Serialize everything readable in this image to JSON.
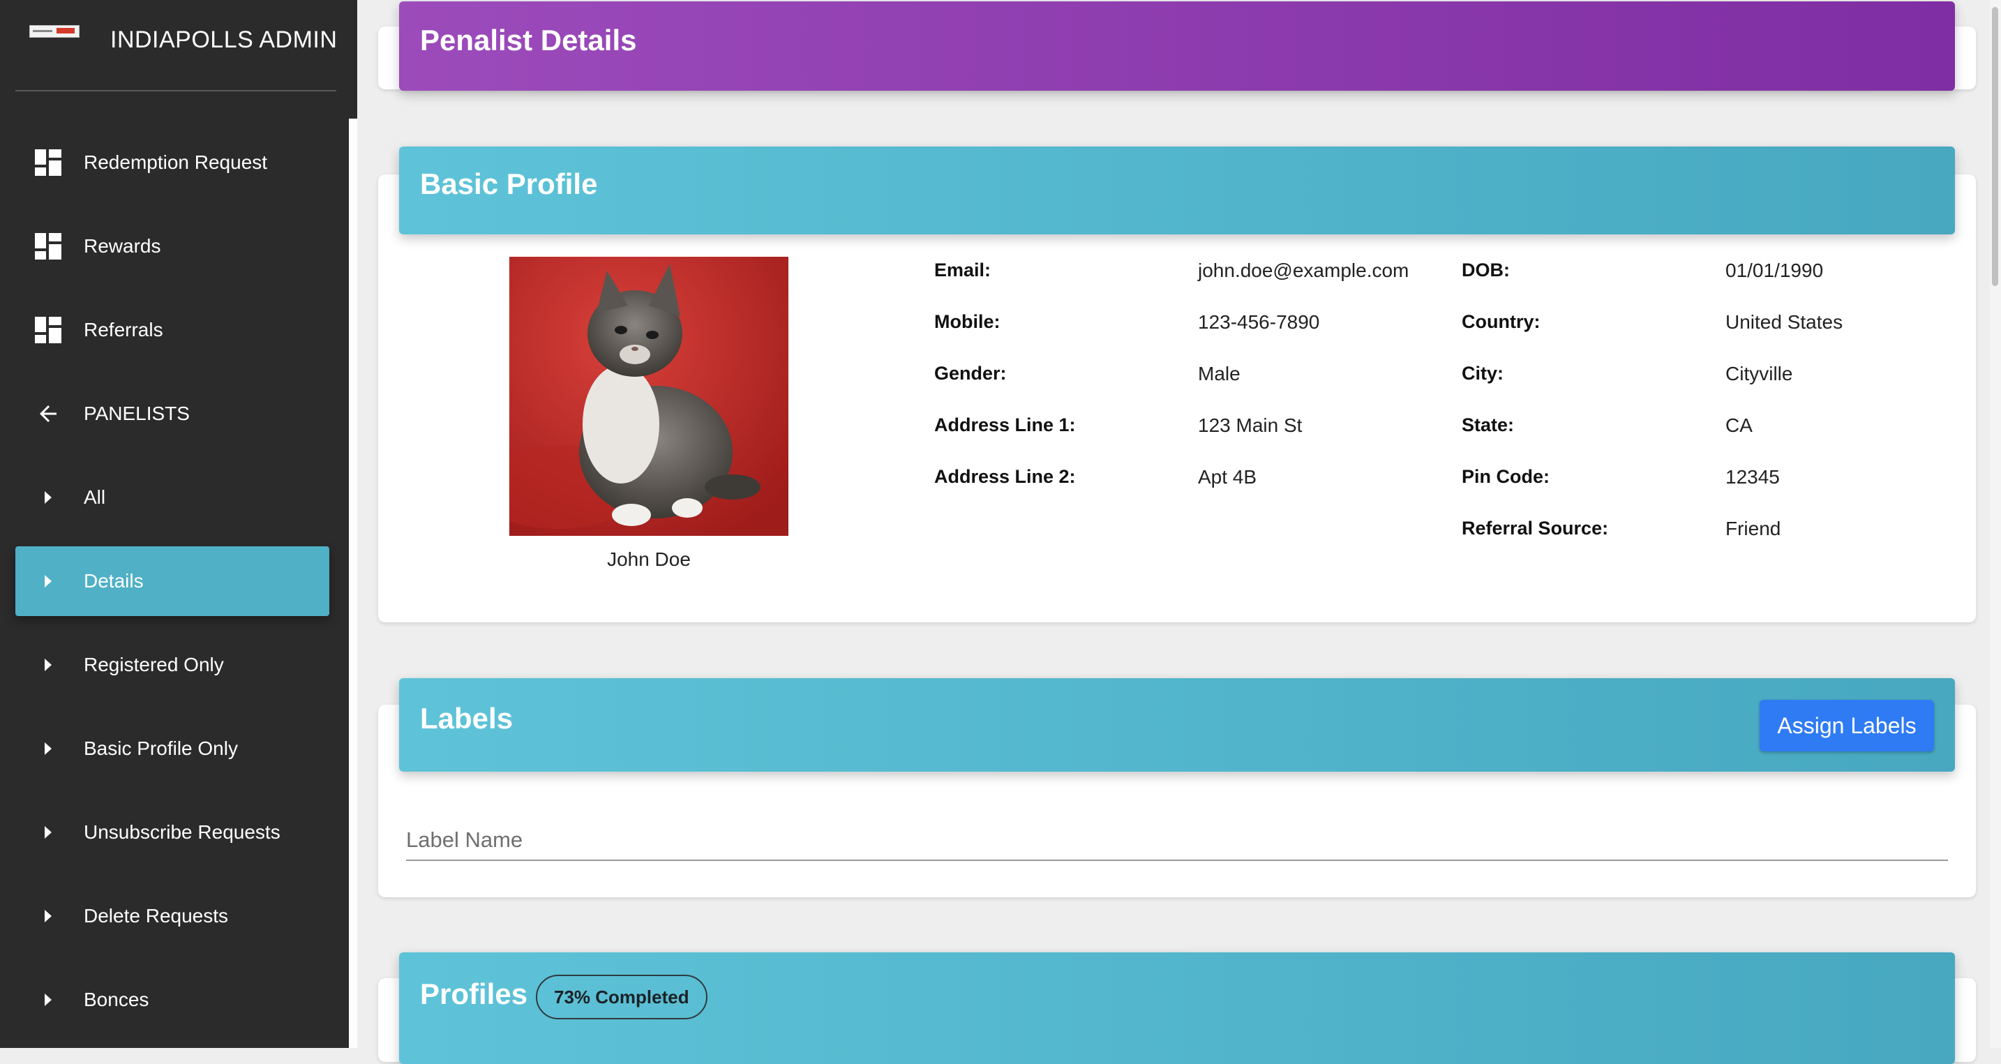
{
  "brand": {
    "title": "INDIAPOLLS ADMIN"
  },
  "sidebar": {
    "items": [
      {
        "label": "Redemption Request",
        "icon": "dashboard-grid-icon"
      },
      {
        "label": "Rewards",
        "icon": "dashboard-grid-icon"
      },
      {
        "label": "Referrals",
        "icon": "dashboard-grid-icon"
      },
      {
        "label": "PANELISTS",
        "icon": "arrow-left-icon"
      },
      {
        "label": "All",
        "icon": "caret-right-icon"
      },
      {
        "label": "Details",
        "icon": "caret-right-icon",
        "active": true
      },
      {
        "label": "Registered Only",
        "icon": "caret-right-icon"
      },
      {
        "label": "Basic Profile Only",
        "icon": "caret-right-icon"
      },
      {
        "label": "Unsubscribe Requests",
        "icon": "caret-right-icon"
      },
      {
        "label": "Delete Requests",
        "icon": "caret-right-icon"
      },
      {
        "label": "Bonces",
        "icon": "caret-right-icon"
      }
    ]
  },
  "page": {
    "title": "Penalist Details"
  },
  "basic_profile": {
    "title": "Basic Profile",
    "name": "John Doe",
    "left_fields": [
      {
        "label": "Email:",
        "value": "john.doe@example.com"
      },
      {
        "label": "Mobile:",
        "value": "123-456-7890"
      },
      {
        "label": "Gender:",
        "value": "Male"
      },
      {
        "label": "Address Line 1:",
        "value": "123 Main St"
      },
      {
        "label": "Address Line 2:",
        "value": "Apt 4B"
      }
    ],
    "right_fields": [
      {
        "label": "DOB:",
        "value": "01/01/1990"
      },
      {
        "label": "Country:",
        "value": "United States"
      },
      {
        "label": "City:",
        "value": "Cityville"
      },
      {
        "label": "State:",
        "value": "CA"
      },
      {
        "label": "Pin Code:",
        "value": "12345"
      },
      {
        "label": "Referral Source:",
        "value": "Friend"
      }
    ]
  },
  "labels": {
    "title": "Labels",
    "assign_button": "Assign Labels",
    "input_placeholder": "Label Name"
  },
  "profiles": {
    "title": "Profiles",
    "badge": "73% Completed"
  },
  "colors": {
    "sidebar_bg": "#2b2b2b",
    "active_item": "#4fb0c6",
    "purple_header": "#8e3fb3",
    "cyan_header": "#53b5cc",
    "assign_button": "#2f7bf4"
  }
}
